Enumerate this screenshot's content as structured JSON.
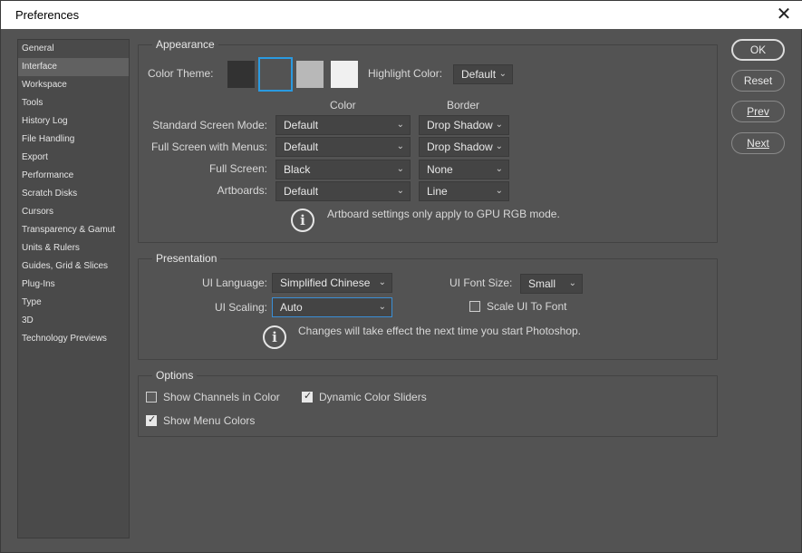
{
  "window": {
    "title": "Preferences",
    "close_glyph": "✕"
  },
  "sidebar": {
    "items": [
      {
        "label": "General"
      },
      {
        "label": "Interface"
      },
      {
        "label": "Workspace"
      },
      {
        "label": "Tools"
      },
      {
        "label": "History Log"
      },
      {
        "label": "File Handling"
      },
      {
        "label": "Export"
      },
      {
        "label": "Performance"
      },
      {
        "label": "Scratch Disks"
      },
      {
        "label": "Cursors"
      },
      {
        "label": "Transparency & Gamut"
      },
      {
        "label": "Units & Rulers"
      },
      {
        "label": "Guides, Grid & Slices"
      },
      {
        "label": "Plug-Ins"
      },
      {
        "label": "Type"
      },
      {
        "label": "3D"
      },
      {
        "label": "Technology Previews"
      }
    ],
    "active_index": 1
  },
  "appearance": {
    "title": "Appearance",
    "color_theme_label": "Color Theme:",
    "themes": [
      {
        "color": "#323232"
      },
      {
        "color": "#535353",
        "selected": true
      },
      {
        "color": "#b8b8b8"
      },
      {
        "color": "#f0f0f0"
      }
    ],
    "highlight_label": "Highlight Color:",
    "highlight_value": "Default",
    "col_color": "Color",
    "col_border": "Border",
    "rows": [
      {
        "label": "Standard Screen Mode:",
        "color": "Default",
        "border": "Drop Shadow"
      },
      {
        "label": "Full Screen with Menus:",
        "color": "Default",
        "border": "Drop Shadow"
      },
      {
        "label": "Full Screen:",
        "color": "Black",
        "border": "None"
      },
      {
        "label": "Artboards:",
        "color": "Default",
        "border": "Line"
      }
    ],
    "note": "Artboard settings only apply to GPU RGB mode."
  },
  "presentation": {
    "title": "Presentation",
    "ui_language_label": "UI Language:",
    "ui_language_value": "Simplified Chinese",
    "ui_font_size_label": "UI Font Size:",
    "ui_font_size_value": "Small",
    "ui_scaling_label": "UI Scaling:",
    "ui_scaling_value": "Auto",
    "scale_ui_to_font_label": "Scale UI To Font",
    "scale_ui_to_font_checked": false,
    "note": "Changes will take effect the next time you start Photoshop."
  },
  "options": {
    "title": "Options",
    "show_channels_label": "Show Channels in Color",
    "show_channels_checked": false,
    "dynamic_sliders_label": "Dynamic Color Sliders",
    "dynamic_sliders_checked": true,
    "show_menu_colors_label": "Show Menu Colors",
    "show_menu_colors_checked": true
  },
  "buttons": {
    "ok": "OK",
    "reset": "Reset",
    "prev": "Prev",
    "next": "Next"
  },
  "icons": {
    "chevron": "⌄",
    "info": "i"
  },
  "colors": {
    "panel_bg": "#535353",
    "accent": "#2a9ae0"
  }
}
